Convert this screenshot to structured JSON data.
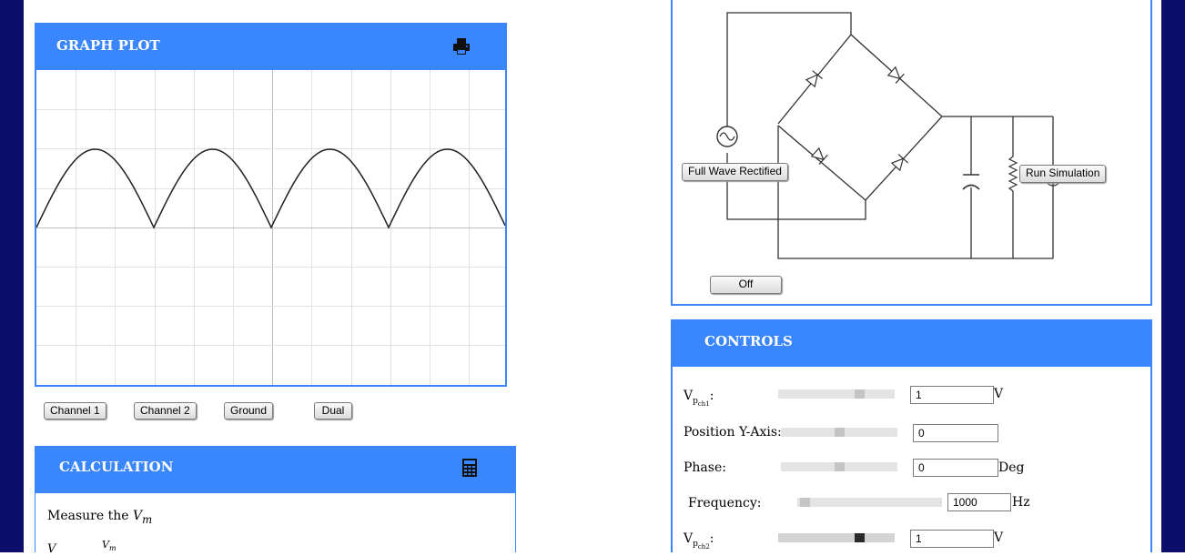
{
  "graph_panel": {
    "title": "GRAPH PLOT",
    "print_icon": "print-icon",
    "buttons": [
      "Channel 1",
      "Channel 2",
      "Ground",
      "Dual"
    ]
  },
  "calculation_panel": {
    "title": "CALCULATION",
    "calc_icon": "calculator-icon",
    "instruction_prefix": "Measure the ",
    "instruction_var": "V",
    "instruction_sub": "m",
    "formula_lhs": "V",
    "formula_num": "V",
    "formula_num_sub": "m"
  },
  "circuit_panel": {
    "mode_button": "Full Wave Rectified",
    "run_button": "Run Simulation",
    "power_button": "Off"
  },
  "controls_panel": {
    "title": "CONTROLS",
    "rows": [
      {
        "label": "V",
        "sub": "p",
        "subsub": "ch1",
        "suffix": ":",
        "value": "1",
        "unit": "V",
        "level": 0.72
      },
      {
        "label": "Position Y-Axis:",
        "value": "0",
        "unit": "",
        "level": 0.5
      },
      {
        "label": "Phase:",
        "value": "0",
        "unit": "Deg",
        "level": 0.5
      },
      {
        "label": "Frequency:",
        "value": "1000",
        "unit": "Hz",
        "level": 0.02
      },
      {
        "label": "V",
        "sub": "p",
        "subsub": "ch2",
        "suffix": ":",
        "value": "1",
        "unit": "V",
        "level": 0.72
      }
    ]
  },
  "colors": {
    "frame": "#0b0f6b",
    "header": "#3a86ff",
    "trace_output": "#222222",
    "trace_input": "#cfcfcf"
  }
}
